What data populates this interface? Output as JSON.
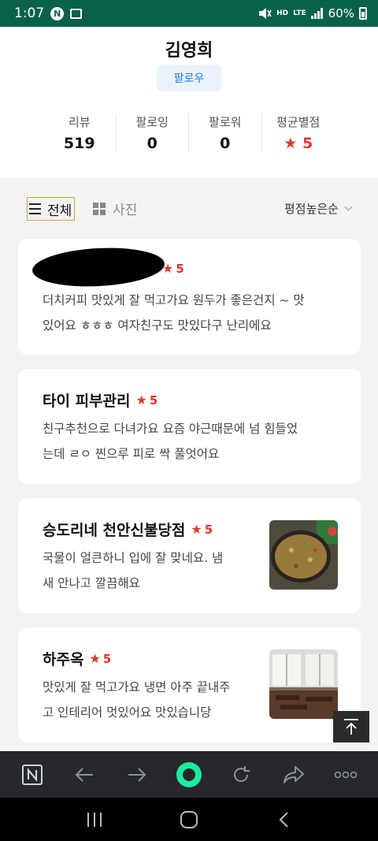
{
  "status_bar": {
    "time": "1:07",
    "notification_icons": [
      "naver-app-icon",
      "gallery-icon"
    ],
    "right_icons": [
      "mute-icon",
      "hd-voice-icon",
      "lte-icon",
      "signal-icon"
    ],
    "hd_label": "HD",
    "lte_label": "LTE",
    "battery": "60%"
  },
  "profile": {
    "name": "김영희",
    "follow_label": "팔로우",
    "stats": [
      {
        "label": "리뷰",
        "value": "519"
      },
      {
        "label": "팔로잉",
        "value": "0"
      },
      {
        "label": "팔로워",
        "value": "0"
      },
      {
        "label": "평균별점",
        "value": "5"
      }
    ]
  },
  "filters": {
    "all_label": "전체",
    "photo_label": "사진",
    "sort_label": "평점높은순"
  },
  "reviews": [
    {
      "name": "",
      "rating": "5",
      "body_lines": [
        "더치커피 맛있게 잘 먹고가요 원두가 좋은건지 ~ 맛",
        "있어요 ㅎㅎㅎ 여자친구도 맛있다구 난리에요"
      ],
      "has_photo": false
    },
    {
      "name": "타이 피부관리",
      "rating": "5",
      "body_lines": [
        "친구추천으로 다녀가요 요즘 야근때문에 넘 힘들었",
        "는데 ㄹㅇ 찐으루 피로 싹 풀엇어요"
      ],
      "has_photo": false
    },
    {
      "name": "승도리네 천안신불당점",
      "rating": "5",
      "body_lines": [
        "국물이 얼큰하니 입에 잘 맞네요. 냄",
        "새 안나고 깔끔해요"
      ],
      "has_photo": true,
      "photo": "food-photo"
    },
    {
      "name": "하주옥",
      "rating": "5",
      "body_lines": [
        "맛있게 잘 먹고가요 냉면 아주 끝내주",
        "고 인테리어 멋있어요 맛있습니당"
      ],
      "has_photo": true,
      "photo": "restaurant-interior-photo"
    }
  ],
  "colors": {
    "status_bar": "#09614a",
    "star": "#e2372c",
    "follow_text": "#1e7bd8",
    "follow_bg": "#eaf3fb",
    "navbar": "#26282b",
    "nav_accent": "#1de9a0"
  },
  "browser_nav": [
    "naver-home-icon",
    "back-arrow-icon",
    "forward-arrow-icon",
    "green-dot-icon",
    "refresh-icon",
    "share-icon",
    "more-dots-icon"
  ],
  "system_nav": [
    "recent-apps-icon",
    "home-icon",
    "back-icon"
  ]
}
